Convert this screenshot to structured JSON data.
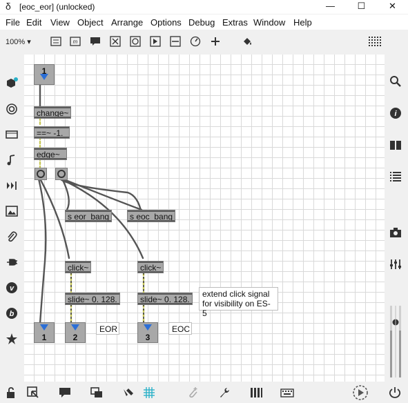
{
  "window": {
    "title": "[eoc_eor] (unlocked)",
    "logo": "max-logo",
    "minimize": "—",
    "maximize": "☐",
    "close": "✕"
  },
  "menu": [
    "File",
    "Edit",
    "View",
    "Object",
    "Arrange",
    "Options",
    "Debug",
    "Extras",
    "Window",
    "Help"
  ],
  "toolbar": {
    "zoom": "100%"
  },
  "objects": {
    "num_top": "1",
    "change": "change~",
    "eq": "==~ -1.",
    "edge": "edge~",
    "s_eor": "s eor_bang",
    "s_eoc": "s eoc_bang",
    "click1": "click~",
    "click2": "click~",
    "slide1": "slide~ 0. 128.",
    "slide2": "slide~ 0. 128.",
    "num_b1": "1",
    "num_b2": "2",
    "num_b3": "3",
    "eor_label": "EOR",
    "eoc_label": "EOC",
    "comment_line1": "extend click signal",
    "comment_line2": "for visibility on ES-5"
  },
  "colors": {
    "number_triangle": "#2c6fd6",
    "signal_patchcord": "#c8c85a",
    "cord": "#555555"
  }
}
